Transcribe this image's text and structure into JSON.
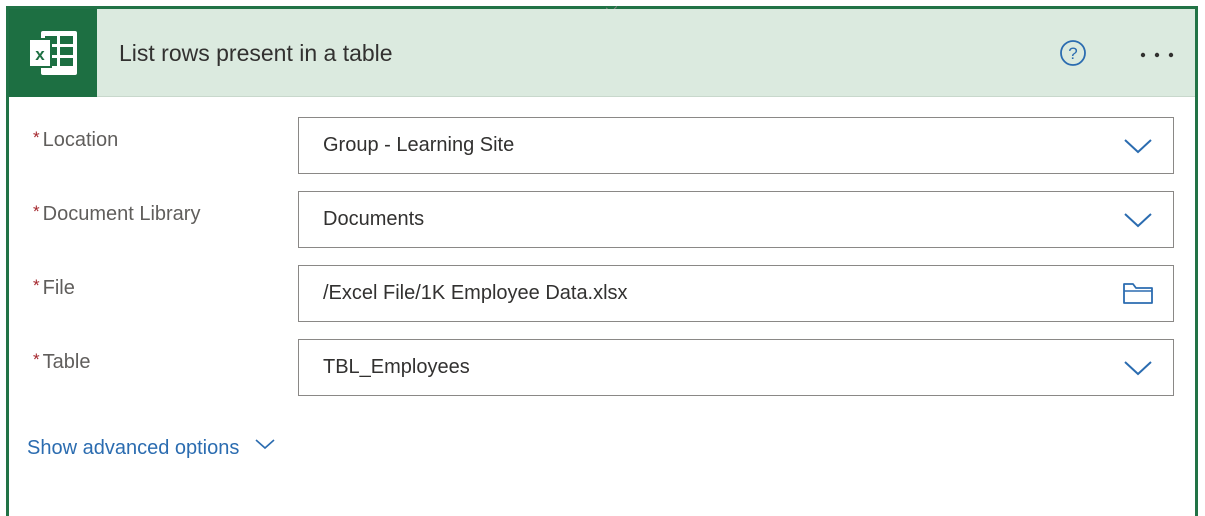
{
  "header": {
    "title": "List rows present in a table",
    "app_icon": "excel-icon",
    "help_icon": "help-circle-icon",
    "more_icon": "ellipsis-icon"
  },
  "fields": [
    {
      "label": "Location",
      "required": "*",
      "value": "Group - Learning Site",
      "icon": "chevron-down-icon"
    },
    {
      "label": "Document Library",
      "required": "*",
      "value": "Documents",
      "icon": "chevron-down-icon"
    },
    {
      "label": "File",
      "required": "*",
      "value": "/Excel File/1K Employee Data.xlsx",
      "icon": "folder-icon"
    },
    {
      "label": "Table",
      "required": "*",
      "value": "TBL_Employees",
      "icon": "chevron-down-icon"
    }
  ],
  "advanced": {
    "label": "Show advanced options",
    "icon": "chevron-down-icon"
  },
  "colors": {
    "accent": "#217346",
    "header_bg": "#dbeadf",
    "link": "#2b6cb0",
    "required": "#a4262c",
    "chevron": "#2b6cb0"
  }
}
